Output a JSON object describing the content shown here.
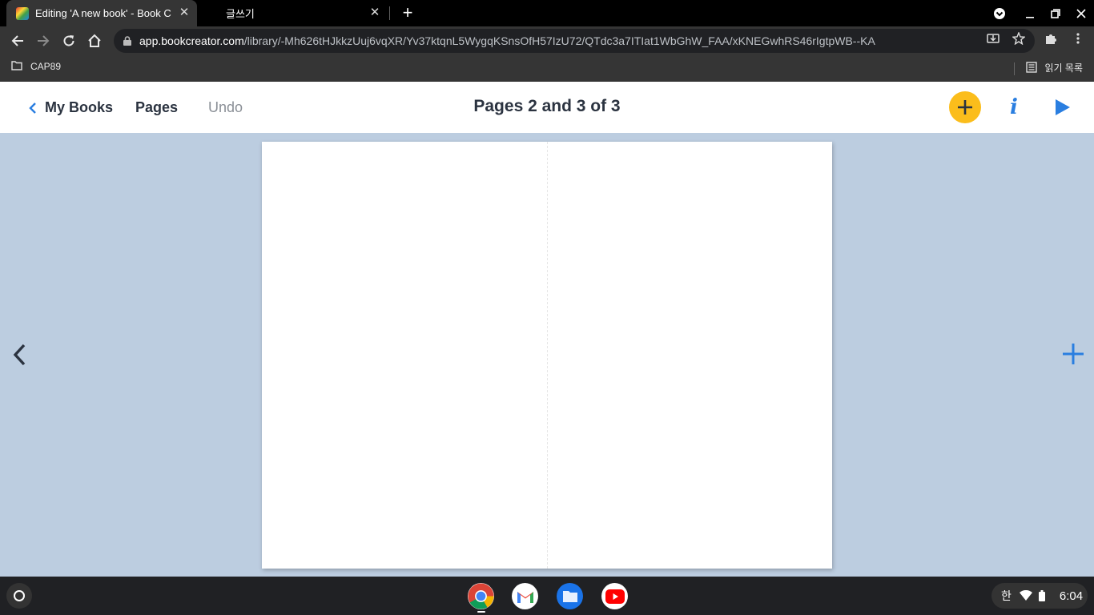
{
  "browser": {
    "tabs": [
      {
        "title": "Editing 'A new book' - Book Creator",
        "active": true
      },
      {
        "title": "글쓰기",
        "active": false
      }
    ],
    "url_host": "app.bookcreator.com",
    "url_path": "/library/-Mh626tHJkkzUuj6vqXR/Yv37ktqnL5WygqKSnsOfH57IzU72/QTdc3a7ITIat1WbGhW_FAA/xKNEGwhRS46rIgtpWB--KA",
    "bookmark": "CAP89",
    "reading_list": "읽기 목록"
  },
  "header": {
    "back_label": "My Books",
    "pages_label": "Pages",
    "undo_label": "Undo",
    "title": "Pages 2 and 3 of 3"
  },
  "colors": {
    "accent_blue": "#2a7ee0",
    "add_yellow": "#fbbd1b",
    "canvas_bg": "#bccde0",
    "text_dark": "#2b3340"
  },
  "icons": {
    "header": [
      "chevron-left-icon",
      "plus-icon",
      "info-icon",
      "play-icon"
    ],
    "canvas": [
      "chevron-left-icon",
      "plus-icon"
    ],
    "shelf": [
      "chrome-icon",
      "gmail-icon",
      "files-icon",
      "youtube-icon"
    ]
  },
  "shelf": {
    "ime": "한",
    "time": "6:04"
  }
}
